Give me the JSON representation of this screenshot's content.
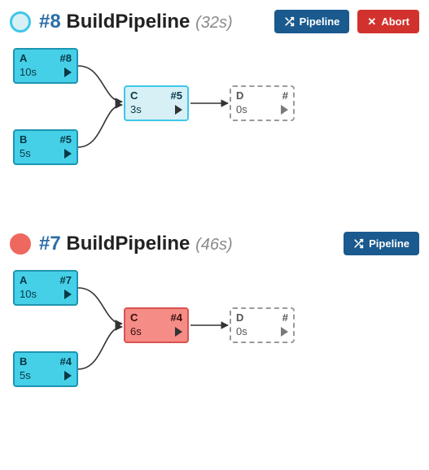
{
  "runs": [
    {
      "status": "running",
      "number_label": "#8",
      "name": "BuildPipeline",
      "duration": "(32s)",
      "buttons": {
        "pipeline": "Pipeline",
        "abort": "Abort"
      },
      "nodes": {
        "A": {
          "name": "A",
          "build": "#8",
          "dur": "10s"
        },
        "B": {
          "name": "B",
          "build": "#5",
          "dur": "5s"
        },
        "C": {
          "name": "C",
          "build": "#5",
          "dur": "3s"
        },
        "D": {
          "name": "D",
          "build": "#",
          "dur": "0s"
        }
      }
    },
    {
      "status": "failed",
      "number_label": "#7",
      "name": "BuildPipeline",
      "duration": "(46s)",
      "buttons": {
        "pipeline": "Pipeline"
      },
      "nodes": {
        "A": {
          "name": "A",
          "build": "#7",
          "dur": "10s"
        },
        "B": {
          "name": "B",
          "build": "#4",
          "dur": "5s"
        },
        "C": {
          "name": "C",
          "build": "#4",
          "dur": "6s"
        },
        "D": {
          "name": "D",
          "build": "#",
          "dur": "0s"
        }
      }
    }
  ]
}
